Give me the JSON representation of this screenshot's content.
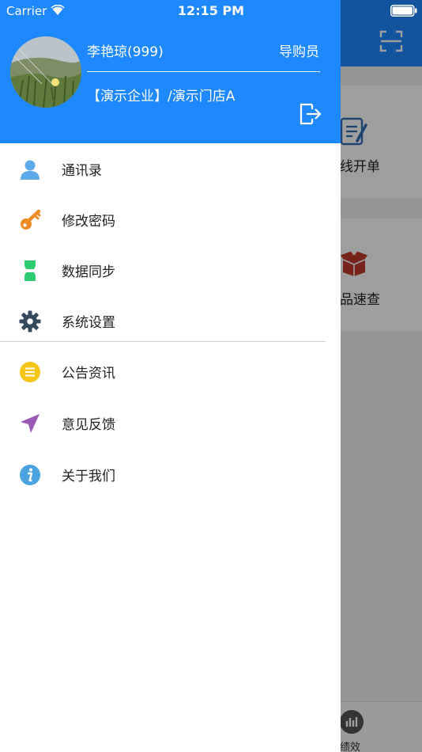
{
  "status_bar": {
    "carrier": "Carrier",
    "time": "12:15 PM"
  },
  "user": {
    "name": "李艳琼(999)",
    "role": "导购员",
    "store": "【演示企业】/演示门店A"
  },
  "menu": [
    {
      "label": "通讯录",
      "icon": "contacts-icon"
    },
    {
      "label": "修改密码",
      "icon": "key-icon"
    },
    {
      "label": "数据同步",
      "icon": "sync-icon"
    },
    {
      "label": "系统设置",
      "icon": "gear-icon"
    },
    {
      "label": "公告资讯",
      "icon": "announcement-icon"
    },
    {
      "label": "意见反馈",
      "icon": "feedback-icon"
    },
    {
      "label": "关于我们",
      "icon": "info-icon"
    }
  ],
  "background": {
    "card1_label": "线开单",
    "card2_label": "品速查",
    "tab_label": "绩效"
  },
  "colors": {
    "primary": "#1e88ff",
    "key": "#f08a24",
    "sync": "#2ecc71",
    "gear": "#34495e",
    "announcement": "#f5c518",
    "feedback": "#9b59b6",
    "info": "#4aa3df"
  }
}
